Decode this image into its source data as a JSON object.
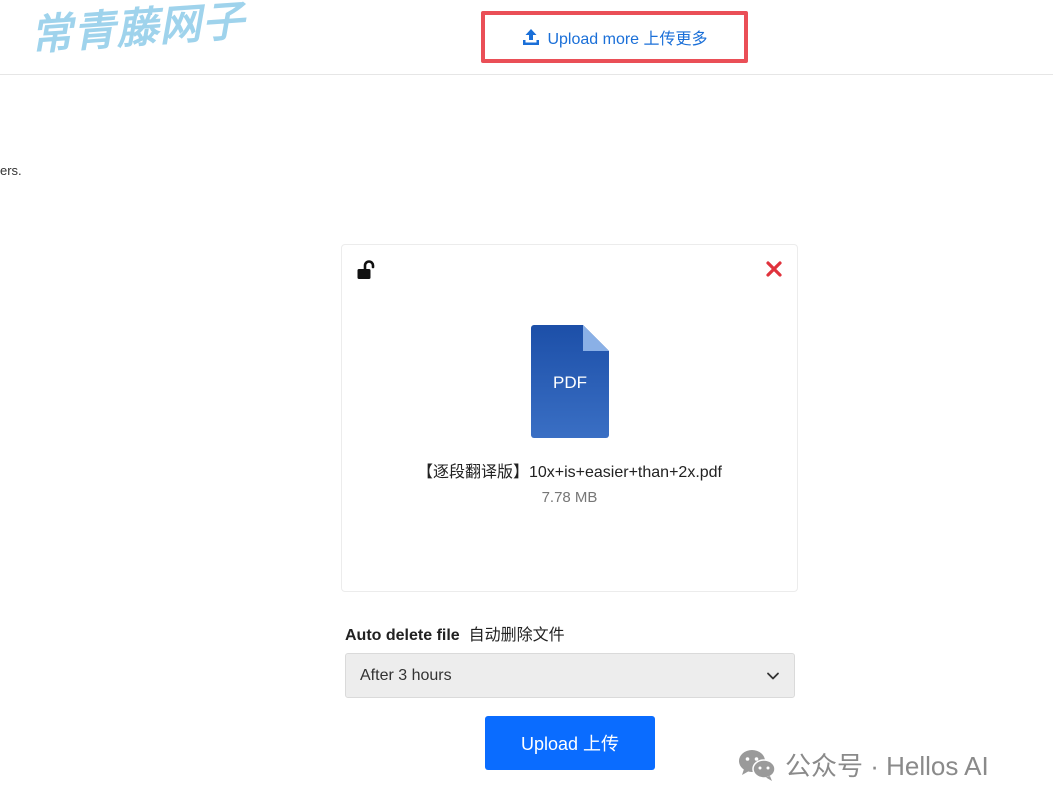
{
  "watermark": "常青藤网子",
  "header": {
    "upload_more_label": "Upload more 上传更多",
    "highlight_color": "#ea4f57",
    "link_color": "#1a6fd8"
  },
  "page": {
    "cut_text": "ers."
  },
  "file_card": {
    "file_type": "PDF",
    "file_name": "【逐段翻译版】10x+is+easier+than+2x.pdf",
    "file_size": "7.78 MB",
    "lock_icon": "unlock-icon",
    "remove_icon": "close-icon",
    "remove_color": "#e0323c"
  },
  "auto_delete": {
    "label_bold": "Auto delete file",
    "label_cn": "自动删除文件",
    "selected": "After 3 hours"
  },
  "upload_button": {
    "label": "Upload  上传",
    "color": "#0a6cff"
  },
  "footer_watermark": {
    "text": "公众号 · Hellos AI",
    "icon": "wechat-icon"
  }
}
